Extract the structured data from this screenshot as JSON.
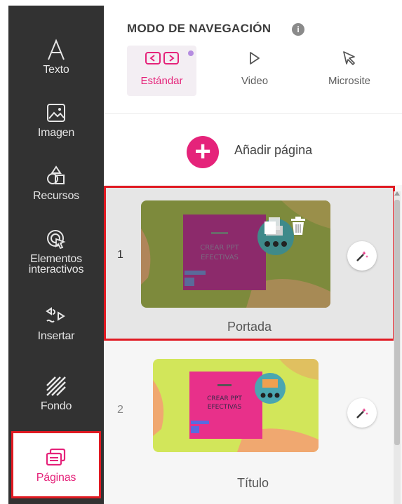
{
  "sidebar": {
    "items": [
      {
        "label": "Texto",
        "icon": "text-icon"
      },
      {
        "label": "Imagen",
        "icon": "image-icon"
      },
      {
        "label": "Recursos",
        "icon": "resources-icon"
      },
      {
        "label": "Elementos interactivos",
        "icon": "interactive-icon"
      },
      {
        "label": "Insertar",
        "icon": "insert-icon"
      },
      {
        "label": "Fondo",
        "icon": "background-icon"
      },
      {
        "label": "Páginas",
        "icon": "pages-icon"
      }
    ],
    "active": "Páginas"
  },
  "navigation": {
    "title": "MODO DE NAVEGACIÓN",
    "info_symbol": "i",
    "options": [
      {
        "label": "Estándar",
        "icon": "standard-nav-icon",
        "selected": true
      },
      {
        "label": "Video",
        "icon": "play-icon",
        "selected": false
      },
      {
        "label": "Microsite",
        "icon": "cursor-icon",
        "selected": false
      }
    ]
  },
  "add_page": {
    "symbol": "+",
    "label": "Añadir página"
  },
  "pages": [
    {
      "number": "1",
      "label": "Portada",
      "thumb_title": "CREAR PPT EFECTIVAS",
      "selected": true
    },
    {
      "number": "2",
      "label": "Título",
      "thumb_title": "CREAR PPT EFECTIVAS",
      "selected": false
    }
  ],
  "colors": {
    "accent": "#e5237a",
    "sidebar_bg": "#323232",
    "highlight_border": "#e01a22"
  }
}
